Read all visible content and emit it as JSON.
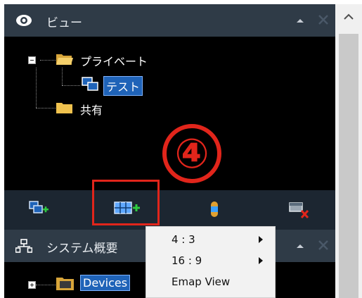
{
  "view_pane": {
    "title": "ビュー",
    "tree": {
      "private_label": "プライベート",
      "test_label": "テスト",
      "shared_label": "共有"
    }
  },
  "toolbar": {
    "tools": [
      "new-view-icon",
      "new-layout-icon",
      "camera-icon",
      "delete-view-icon"
    ]
  },
  "annotation": {
    "step_badge": "④",
    "accent_color": "#e1251b"
  },
  "system_pane": {
    "title": "システム概要",
    "tree": {
      "devices_label": "Devices"
    }
  },
  "context_menu": {
    "items": [
      {
        "label": "4 : 3"
      },
      {
        "label": "16 : 9"
      },
      {
        "label": "Emap View"
      }
    ]
  }
}
